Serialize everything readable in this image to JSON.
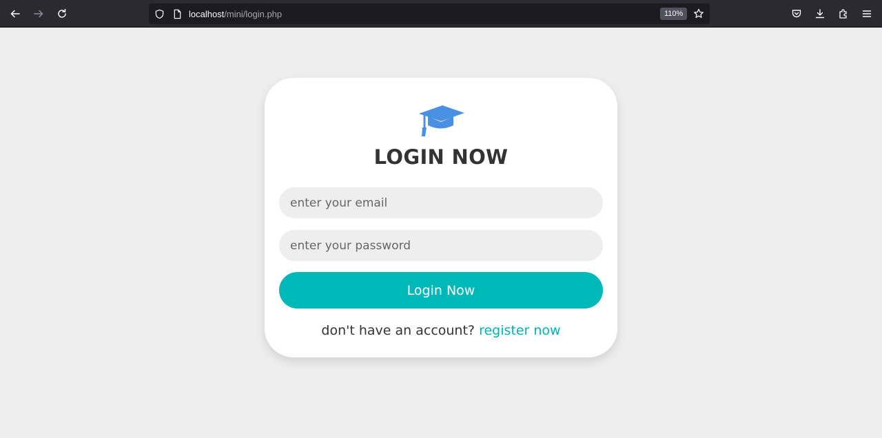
{
  "browser": {
    "url_host": "localhost",
    "url_path": "/mini/login.php",
    "zoom": "110%",
    "icons": {
      "back": "arrow-left-icon",
      "forward": "arrow-right-icon",
      "reload": "reload-icon",
      "site_info": "shield-icon",
      "page": "page-icon",
      "bookmark": "star-icon",
      "pocket": "pocket-icon",
      "downloads": "download-icon",
      "extensions": "puzzle-icon",
      "menu": "hamburger-menu-icon"
    }
  },
  "login_form": {
    "logo_icon": "graduation-cap-icon",
    "title": "LOGIN NOW",
    "email_placeholder": "enter your email",
    "password_placeholder": "enter your password",
    "submit_label": "Login Now",
    "footer_text": "don't have an account?",
    "register_link": "register now"
  },
  "colors": {
    "page_background": "#eeeeee",
    "card_background": "#ffffff",
    "accent": "#00b8b8",
    "logo_blue": "#4a90e2",
    "title_text": "#333333",
    "browser_toolbar": "#2b2a33"
  }
}
